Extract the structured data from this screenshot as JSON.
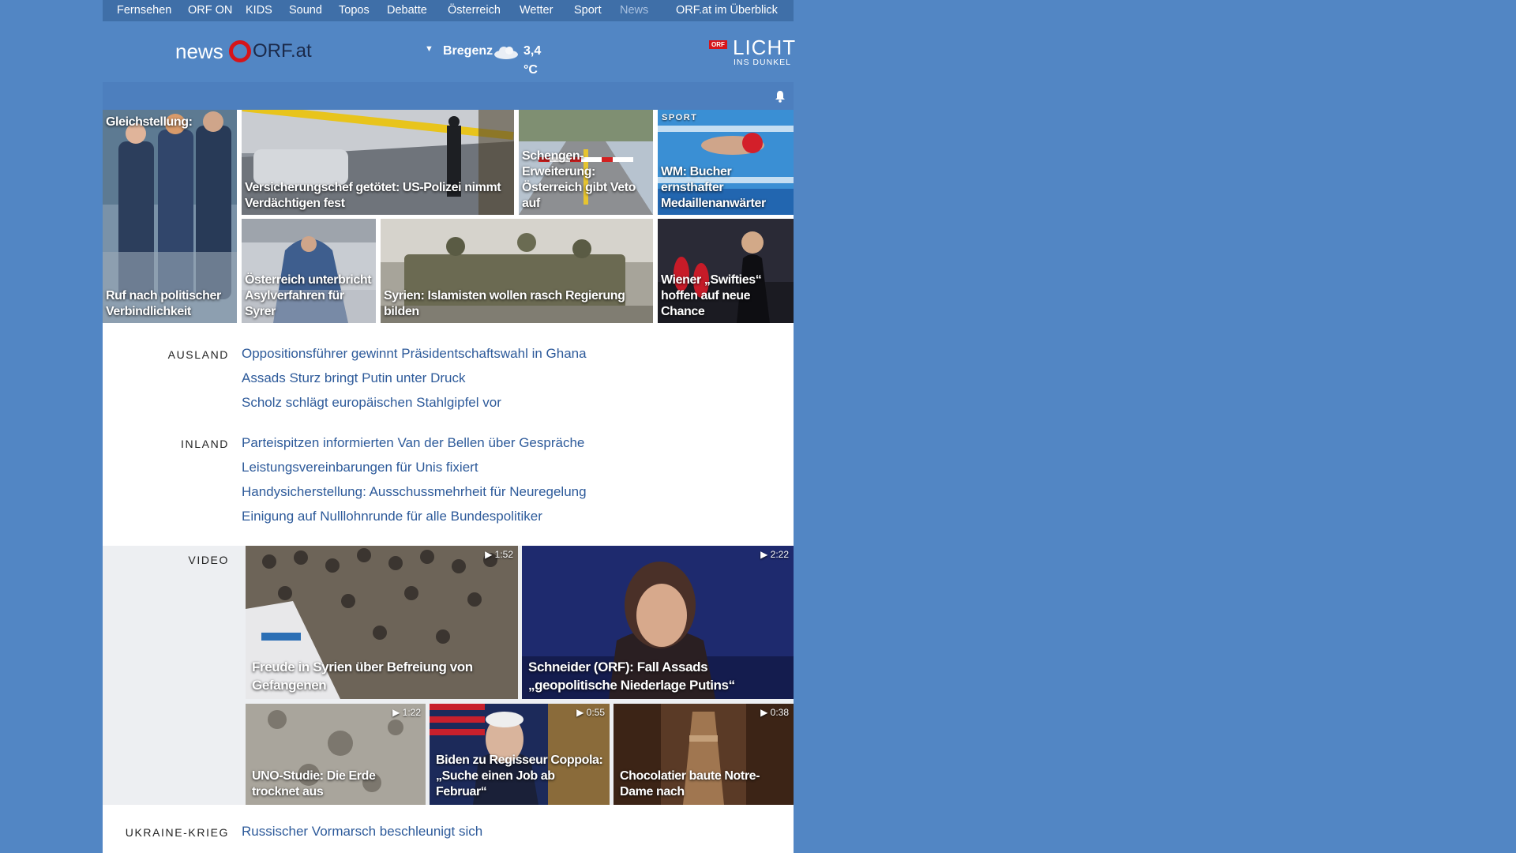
{
  "nav": {
    "items": [
      "Fernsehen",
      "ORF ON",
      "KIDS",
      "Sound",
      "Topos",
      "Debatte",
      "Österreich",
      "Wetter",
      "Sport",
      "News"
    ],
    "overview": "ORF.at im Überblick"
  },
  "header": {
    "logo_news": "news",
    "logo_orf": "ORF.at",
    "weather_city": "Bregenz",
    "weather_temp": "3,4 °C",
    "promo_badge": "ORF",
    "promo_title": "LICHT",
    "promo_sub": "INS DUNKEL"
  },
  "top_stories": [
    {
      "caption_top": "Gleichstellung:",
      "caption": "Ruf nach politischer Verbindlichkeit"
    },
    {
      "caption": "Versicherungschef getötet: US-Polizei nimmt Verdächtigen fest"
    },
    {
      "caption": "Schengen-Erweiterung: Österreich gibt Veto auf"
    },
    {
      "kicker": "SPORT",
      "caption": "WM: Bucher ernsthafter Medaillenanwärter"
    },
    {
      "caption": "Österreich unterbricht Asylverfahren für Syrer"
    },
    {
      "caption": "Syrien: Islamisten wollen rasch Regierung bilden"
    },
    {
      "caption": "Wiener „Swifties“ hoffen auf neue Chance"
    }
  ],
  "sections": {
    "ausland": {
      "label": "AUSLAND",
      "items": [
        "Oppositionsführer gewinnt Präsidentschaftswahl in Ghana",
        "Assads Sturz bringt Putin unter Druck",
        "Scholz schlägt europäischen Stahlgipfel vor"
      ]
    },
    "inland": {
      "label": "INLAND",
      "items": [
        "Parteispitzen informierten Van der Bellen über Gespräche",
        "Leistungsvereinbarungen für Unis fixiert",
        "Handysicherstellung: Ausschussmehrheit für Neuregelung",
        "Einigung auf Nulllohnrunde für alle Bundespolitiker"
      ]
    },
    "video": {
      "label": "VIDEO",
      "items": [
        {
          "duration": "1:52",
          "caption": "Freude in Syrien über Befreiung von Gefangenen"
        },
        {
          "duration": "2:22",
          "caption": "Schneider (ORF): Fall Assads „geopolitische Niederlage Putins“"
        },
        {
          "duration": "1:22",
          "caption": "UNO-Studie: Die Erde trocknet aus"
        },
        {
          "duration": "0:55",
          "caption": "Biden zu Regisseur Coppola: „Suche einen Job ab Februar“"
        },
        {
          "duration": "0:38",
          "caption": "Chocolatier baute Notre-Dame nach"
        }
      ]
    },
    "ukraine": {
      "label": "UKRAINE-KRIEG",
      "items": [
        "Russischer Vormarsch beschleunigt sich"
      ]
    }
  }
}
